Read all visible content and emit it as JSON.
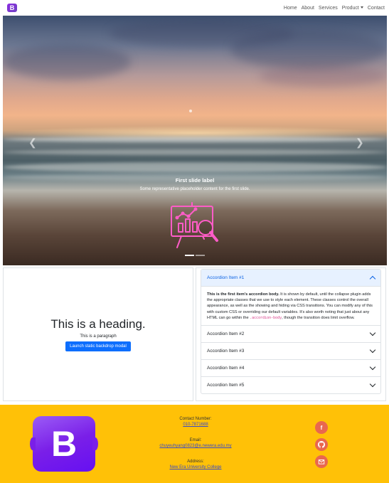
{
  "navbar": {
    "brand_letter": "B",
    "links": [
      "Home",
      "About",
      "Services",
      "Product",
      "Contact"
    ]
  },
  "carousel": {
    "slide_label": "First slide label",
    "slide_text": "Some representative placeholder content for the first slide.",
    "indicator_count": 2,
    "active_indicator": 0
  },
  "hero": {
    "heading": "This is a heading.",
    "paragraph": "This is a paragraph",
    "button_label": "Launch static backdrop modal"
  },
  "accordion": {
    "items": [
      {
        "title": "Accordion Item #1",
        "open": true
      },
      {
        "title": "Accordion Item #2",
        "open": false
      },
      {
        "title": "Accordion Item #3",
        "open": false
      },
      {
        "title": "Accordion Item #4",
        "open": false
      },
      {
        "title": "Accordion Item #5",
        "open": false
      }
    ],
    "body_strong": "This is the first item's accordion body.",
    "body_text_1": " It is shown by default, until the collapse plugin adds the appropriate classes that we use to style each element. These classes control the overall appearance, as well as the showing and hiding via CSS transitions. You can modify any of this with custom CSS or overriding our default variables. It's also worth noting that just about any HTML can go within the ",
    "body_code": ".accordion-body",
    "body_text_2": ", though the transition does limit overflow."
  },
  "footer": {
    "logo_letter": "B",
    "contact_label": "Contact Number:",
    "contact_value": "010-7871688",
    "email_label": "Email:",
    "email_value": "chuyeuhyang0823@e.newera.edu.my",
    "address_label": "Address:",
    "address_value": "New Era University College",
    "social_icons": [
      "facebook-icon",
      "github-icon",
      "email-icon"
    ]
  },
  "colors": {
    "footer_bg": "#ffc107",
    "primary": "#0d6efd",
    "social_bg": "#e9674f",
    "brand": "#7a1fe8"
  }
}
